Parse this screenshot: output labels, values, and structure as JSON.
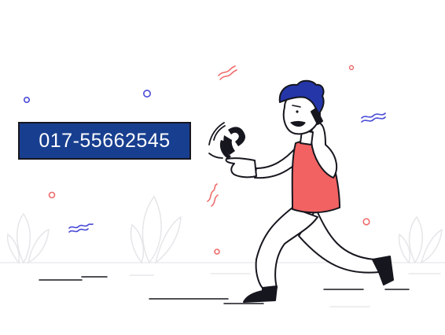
{
  "banner": {
    "phone_number": "017-55662545"
  },
  "colors": {
    "box_fill": "#183f8f",
    "shirt": "#f26262",
    "hair": "#2436a8",
    "squiggle_red": "#ef6b6b",
    "squiggle_blue": "#4a4ad8",
    "outline": "#16161e"
  },
  "icons": [
    "phone-handset-icon",
    "signal-waves-icon",
    "plant-decoration-icon"
  ]
}
